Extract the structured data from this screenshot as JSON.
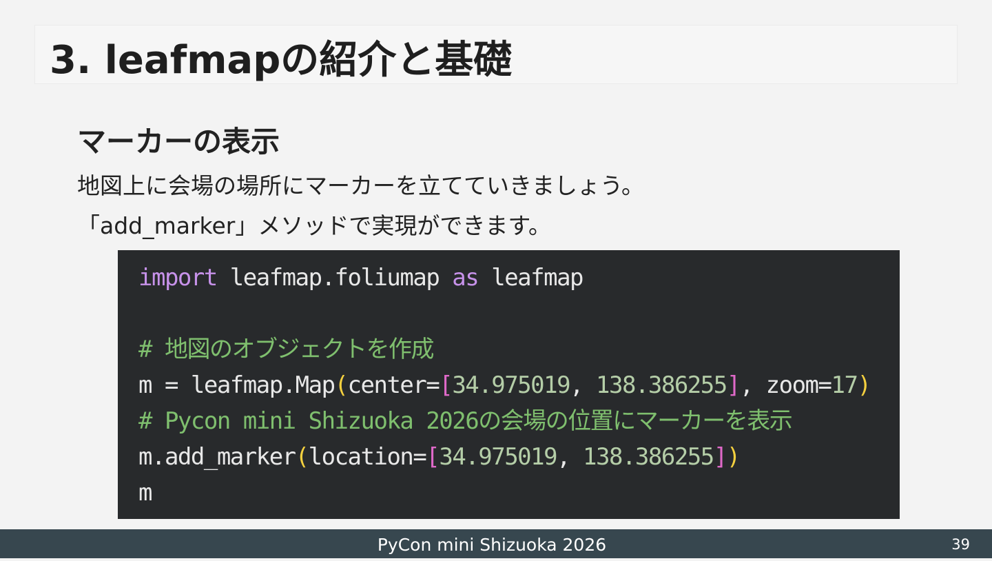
{
  "slide": {
    "title": "3. leafmapの紹介と基礎",
    "section_heading": "マーカーの表示",
    "body_lines": [
      "地図上に会場の場所にマーカーを立てていきましょう。",
      "「add_marker」メソッドで実現ができます。"
    ]
  },
  "code": {
    "line1": {
      "kw_import": "import",
      "module": " leafmap.foliumap ",
      "kw_as": "as",
      "alias": " leafmap"
    },
    "line3": {
      "comment": "# 地図のオブジェクトを作成"
    },
    "line4": {
      "prefix": "m = leafmap.Map",
      "open_paren": "(",
      "arg_center": "center=",
      "open_bracket": "[",
      "lat": "34.975019",
      "sep": ", ",
      "lon": "138.386255",
      "close_bracket": "]",
      "arg_zoom": ", zoom=",
      "zoom": "17",
      "close_paren": ")"
    },
    "line5": {
      "comment": "# Pycon mini Shizuoka 2026の会場の位置にマーカーを表示"
    },
    "line6": {
      "prefix": "m.add_marker",
      "open_paren": "(",
      "arg_location": "location=",
      "open_bracket": "[",
      "lat": "34.975019",
      "sep": ", ",
      "lon": "138.386255",
      "close_bracket": "]",
      "close_paren": ")"
    },
    "line7": {
      "text": "m"
    }
  },
  "footer": {
    "event_name": "PyCon mini Shizuoka 2026",
    "page_number": "39"
  },
  "colors": {
    "background": "#f3f3f3",
    "code_background": "#282a2c",
    "footer_background": "#37474f",
    "keyword": "#c792ea",
    "comment": "#7fbf6e",
    "number": "#b5cea8",
    "paren": "#f4d03f",
    "bracket": "#e069c9"
  }
}
